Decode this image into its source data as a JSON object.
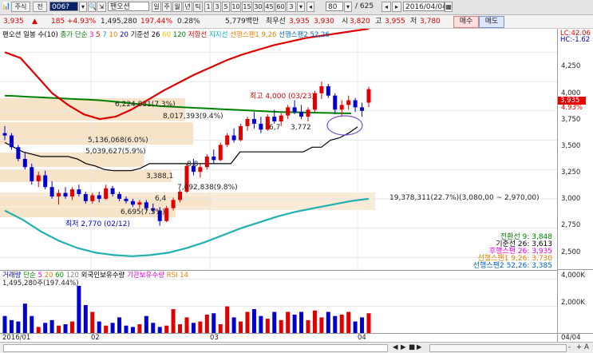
{
  "toolbar": {
    "market_label": "주식",
    "all_label": "전",
    "code": "006?70",
    "name": "팬오션",
    "period_tabs": [
      "주",
      "월",
      "년",
      "틱"
    ],
    "minute_tabs": [
      "1",
      "3",
      "5",
      "10",
      "15",
      "30",
      "45",
      "60"
    ],
    "count": "80",
    "page": "/ 625",
    "date": "2016/04/04"
  },
  "quote": {
    "price": "3,935",
    "change_arrow": "▲",
    "change": "185",
    "change_pct": "+4.93%",
    "volume": "1,495,280",
    "volume_ratio": "197.44%",
    "turnover_rate": "0.28%",
    "amount": "5,779백만",
    "best_ask_label": "최우선",
    "best_ask": "3,935",
    "best_bid": "3,930",
    "open_label": "시",
    "open": "3,820",
    "high_label": "고",
    "high": "3,955",
    "low_label": "저",
    "low": "3,780",
    "buy_label": "매수",
    "sell_label": "매도"
  },
  "price_panel": {
    "legend": [
      {
        "text": "팬오션 일봉 수(10)",
        "color": "#000000"
      },
      {
        "text": "종가 단순",
        "color": "#008000"
      },
      {
        "text": "3",
        "color": "#e600e6"
      },
      {
        "text": "5",
        "color": "#e60000"
      },
      {
        "text": "7",
        "color": "#00a0e6"
      },
      {
        "text": "10",
        "color": "#ff8000"
      },
      {
        "text": "20",
        "color": "#0000c8"
      },
      {
        "text": "기준선 26",
        "color": "#000000"
      },
      {
        "text": "60",
        "color": "#e6c800"
      },
      {
        "text": "120",
        "color": "#008000"
      },
      {
        "text": "저항선",
        "color": "#e60000"
      },
      {
        "text": "지지선",
        "color": "#00b4b4"
      },
      {
        "text": "선행스팬1 9,26",
        "color": "#e68000"
      },
      {
        "text": "선행스팬2 52,26",
        "color": "#0064c8"
      }
    ],
    "top_right": [
      "LC:42.06",
      "HC:-1.62"
    ],
    "annotations": [
      "6,224,831(7.3%)",
      "8,017,393(9.4%)",
      "5,136,068(6.0%)",
      "5,039,627(5.9%)",
      "최고 4,000 (03/23)",
      "3,772",
      "6,7",
      "8,8",
      "3,388,1",
      "7,092,838(9.8%)",
      "6,4",
      "6,695(7.5%)",
      "최저 2,770 (02/12)",
      "19,378,311(22.7%)(3,080,00 ~ 2,970,00)"
    ],
    "right_legend": [
      {
        "text": "전환선 9: 3,848",
        "color": "#008000"
      },
      {
        "text": "기준선 26: 3,613",
        "color": "#000000"
      },
      {
        "text": "후행스팬 26: 3,935",
        "color": "#e600e6"
      },
      {
        "text": "선행스팬1 9,26: 3,730",
        "color": "#e68000"
      },
      {
        "text": "선행스팬2 52,26: 3,385",
        "color": "#0064c8"
      }
    ]
  },
  "price_axis": [
    "4,250",
    "4,000",
    "3,935",
    "4.93%",
    "3,750",
    "3,500",
    "3,250",
    "3,000",
    "2,750",
    "2,500"
  ],
  "volume_panel": {
    "legend": [
      {
        "text": "거래량",
        "color": "#0000c8"
      },
      {
        "text": "단순",
        "color": "#008000"
      },
      {
        "text": "5",
        "color": "#e600e6"
      },
      {
        "text": "20",
        "color": "#e68000"
      },
      {
        "text": "60",
        "color": "#00a000"
      },
      {
        "text": "120",
        "color": "#888888"
      },
      {
        "text": "외국인보유수량",
        "color": "#000000"
      },
      {
        "text": "기관보유수량",
        "color": "#e600e6"
      },
      {
        "text": "RSI 14",
        "color": "#e68000"
      }
    ],
    "current": "1,495,280주(197.44%)",
    "axis": [
      "4,000K",
      "2,000K"
    ]
  },
  "date_axis": [
    "2016/01",
    "02",
    "03",
    "04"
  ],
  "date_right": "04/04",
  "chart_data": {
    "type": "candlestick",
    "period": "daily",
    "ylim": [
      2400,
      4450
    ],
    "price_high": {
      "value": 4000,
      "date": "03/23"
    },
    "price_low": {
      "value": 2770,
      "date": "02/12"
    },
    "candles": [
      [
        3560,
        3620,
        3500,
        3540
      ],
      [
        3540,
        3560,
        3420,
        3440
      ],
      [
        3440,
        3460,
        3320,
        3340
      ],
      [
        3340,
        3400,
        3250,
        3270
      ],
      [
        3270,
        3300,
        3120,
        3150
      ],
      [
        3150,
        3230,
        3100,
        3200
      ],
      [
        3200,
        3240,
        3080,
        3100
      ],
      [
        3100,
        3150,
        3000,
        3020
      ],
      [
        3020,
        3080,
        2950,
        3050
      ],
      [
        3050,
        3100,
        3000,
        3020
      ],
      [
        3020,
        3100,
        2990,
        3080
      ],
      [
        3080,
        3120,
        3020,
        3040
      ],
      [
        3040,
        3060,
        2960,
        2980
      ],
      [
        2980,
        3050,
        2960,
        3030
      ],
      [
        3030,
        3060,
        2970,
        3000
      ],
      [
        3000,
        3120,
        2990,
        3090
      ],
      [
        3090,
        3110,
        3020,
        3040
      ],
      [
        3040,
        3060,
        2980,
        3000
      ],
      [
        3000,
        3020,
        2960,
        2980
      ],
      [
        2980,
        3000,
        2930,
        2950
      ],
      [
        2950,
        2990,
        2920,
        2970
      ],
      [
        2970,
        2990,
        2900,
        2920
      ],
      [
        2920,
        2960,
        2880,
        2900
      ],
      [
        2900,
        2930,
        2770,
        2810
      ],
      [
        2810,
        2940,
        2800,
        2920
      ],
      [
        2920,
        3010,
        2900,
        2990
      ],
      [
        2990,
        3080,
        2970,
        3060
      ],
      [
        3060,
        3300,
        3050,
        3280
      ],
      [
        3280,
        3340,
        3200,
        3230
      ],
      [
        3230,
        3300,
        3180,
        3270
      ],
      [
        3270,
        3380,
        3250,
        3360
      ],
      [
        3360,
        3420,
        3300,
        3330
      ],
      [
        3330,
        3480,
        3320,
        3460
      ],
      [
        3460,
        3560,
        3440,
        3540
      ],
      [
        3540,
        3600,
        3480,
        3500
      ],
      [
        3500,
        3640,
        3490,
        3620
      ],
      [
        3620,
        3700,
        3580,
        3680
      ],
      [
        3680,
        3740,
        3600,
        3640
      ],
      [
        3640,
        3700,
        3560,
        3590
      ],
      [
        3590,
        3720,
        3580,
        3700
      ],
      [
        3700,
        3760,
        3640,
        3660
      ],
      [
        3660,
        3730,
        3620,
        3710
      ],
      [
        3710,
        3800,
        3680,
        3780
      ],
      [
        3780,
        3840,
        3720,
        3740
      ],
      [
        3740,
        3800,
        3680,
        3700
      ],
      [
        3700,
        3780,
        3660,
        3760
      ],
      [
        3760,
        3920,
        3740,
        3900
      ],
      [
        3900,
        4000,
        3850,
        3960
      ],
      [
        3960,
        3980,
        3860,
        3880
      ],
      [
        3880,
        3900,
        3720,
        3760
      ],
      [
        3760,
        3840,
        3700,
        3800
      ],
      [
        3800,
        3880,
        3760,
        3840
      ],
      [
        3840,
        3860,
        3740,
        3780
      ],
      [
        3780,
        3820,
        3700,
        3750
      ],
      [
        3820,
        3955,
        3780,
        3935
      ]
    ],
    "moving_averages": [
      {
        "name": "기준선 26",
        "values": [
          3480,
          3440,
          3400,
          3380,
          3360,
          3360,
          3360,
          3360,
          3340,
          3300,
          3280,
          3250,
          3240,
          3240,
          3240,
          3260,
          3300,
          3300,
          3300,
          3300,
          3300,
          3300,
          3300,
          3300,
          3300,
          3300,
          3400,
          3400,
          3400,
          3400,
          3400,
          3400,
          3400,
          3400,
          3440,
          3440,
          3500,
          3520,
          3560,
          3613
        ]
      },
      {
        "name": "120",
        "values": [
          3880,
          3875,
          3870,
          3865,
          3860,
          3855,
          3850,
          3845,
          3840,
          3830,
          3820,
          3810,
          3800,
          3790,
          3785,
          3780,
          3775,
          3770,
          3765,
          3760,
          3755,
          3750,
          3745,
          3740,
          3738,
          3736,
          3734,
          3732,
          3730,
          3728
        ]
      },
      {
        "name": "저항선",
        "values": [
          4250,
          4200,
          4050,
          3900,
          3800,
          3720,
          3680,
          3700,
          3760,
          3840,
          3920,
          3990,
          4060,
          4120,
          4180,
          4230,
          4270,
          4310,
          4340,
          4370,
          4390,
          4410,
          4430,
          4450
        ]
      },
      {
        "name": "지지선",
        "values": [
          2900,
          2820,
          2720,
          2640,
          2580,
          2540,
          2520,
          2510,
          2520,
          2540,
          2580,
          2630,
          2690,
          2750,
          2800,
          2850,
          2890,
          2920,
          2950,
          2980,
          3000
        ]
      }
    ],
    "volume": [
      1.3,
      1.0,
      0.9,
      2.2,
      1.3,
      0.5,
      0.8,
      1.0,
      0.6,
      0.7,
      0.9,
      3.5,
      2.1,
      1.6,
      0.9,
      0.6,
      0.8,
      1.2,
      0.6,
      0.5,
      0.7,
      1.3,
      0.8,
      0.5,
      0.6,
      1.8,
      0.7,
      1.2,
      0.8,
      0.9,
      1.4,
      1.5,
      0.7,
      2.0,
      1.2,
      0.9,
      1.6,
      1.8,
      1.3,
      1.1,
      1.6,
      1.0,
      1.6,
      1.4,
      1.6,
      1.0,
      1.7,
      1.2,
      1.6,
      1.3,
      1.4,
      1.6,
      0.9,
      1.2,
      1.5
    ],
    "volume_unit": "M"
  },
  "status_bar": {
    "nav": [
      "◀",
      "▶",
      "■",
      "▶"
    ],
    "zoom": [
      "-",
      "+",
      "A"
    ]
  }
}
